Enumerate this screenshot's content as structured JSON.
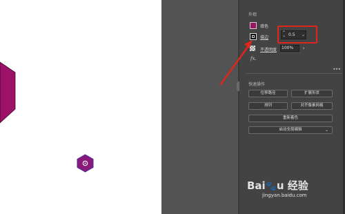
{
  "appearance": {
    "title": "外观",
    "fill_label": "填色",
    "stroke_label": "描边",
    "stroke_value": "0.5",
    "opacity_label": "不透明度",
    "opacity_value": "100%",
    "fx_label": "fx."
  },
  "quick_actions": {
    "title": "快速操作",
    "offset_path": "位移路径",
    "expand_shape": "扩展形状",
    "arrange": "排列",
    "align_pixel_grid": "对齐像素网格",
    "recolor": "重新着色",
    "start_global_edit": "启动全局编辑"
  },
  "icons": {
    "more": "more-dots-icon",
    "stepper": "stepper-icon",
    "dropdown": "chevron-down-icon",
    "arrow": "chevron-right-icon"
  },
  "colors": {
    "fill": "#9b1268",
    "annotation": "#e0251b",
    "panel": "#434343"
  },
  "watermark": {
    "logo": "Bai 经验",
    "url": "jingyan.baidu.com"
  }
}
